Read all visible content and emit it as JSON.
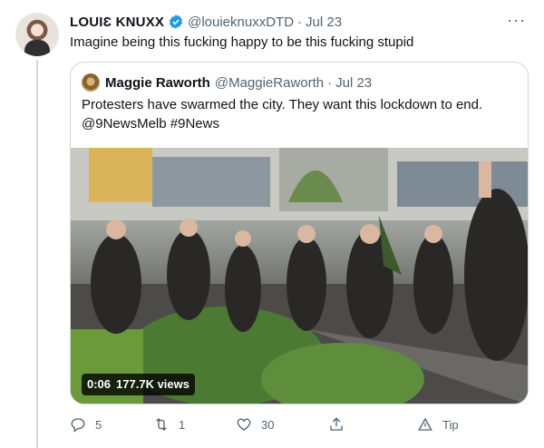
{
  "tweet": {
    "author_name": "LOUIƐ KNUXX",
    "handle": "@louieknuxxDTD",
    "separator": "·",
    "date": "Jul 23",
    "more_label": "···",
    "text": "Imagine being this fucking happy to be this fucking stupid"
  },
  "quote": {
    "author_name": "Maggie Raworth",
    "handle": "@MaggieRaworth",
    "separator": "·",
    "date": "Jul 23",
    "text": "Protesters have swarmed the city. They want this lockdown to end. @9NewsMelb #9News",
    "video": {
      "duration": "0:06",
      "views": "177.7K views"
    }
  },
  "actions": {
    "reply_count": "5",
    "retweet_count": "1",
    "like_count": "30",
    "tip_label": "Tip"
  },
  "colors": {
    "accent": "#1d9bf0",
    "secondary_text": "#536471",
    "border": "#cfd9de"
  },
  "icons": [
    "verified-icon",
    "more-icon",
    "reply-icon",
    "retweet-icon",
    "like-icon",
    "share-icon",
    "tip-icon"
  ]
}
